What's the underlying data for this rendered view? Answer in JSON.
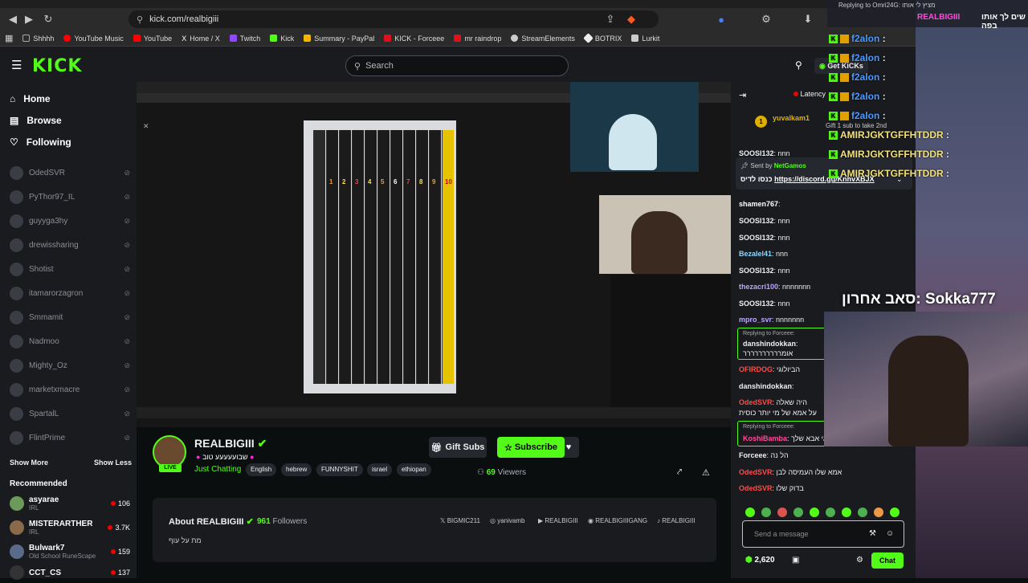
{
  "browser": {
    "url": "kick.com/realbigiii",
    "bookmarks": [
      "Shhhh",
      "YouTube Music",
      "YouTube",
      "Home / X",
      "Twitch",
      "Kick",
      "Summary - PayPal",
      "KICK - Forceee",
      "mr raindrop",
      "StreamElements",
      "BOTRIX",
      "Lurkit"
    ]
  },
  "nav": {
    "logo": "KICK",
    "search_placeholder": "Search",
    "home": "Home",
    "browse": "Browse",
    "following": "Following",
    "get_kicks": "Get KiCKs"
  },
  "following_list": [
    "OdedSVR",
    "PyThor97_IL",
    "guyyga3hy",
    "drewissharing",
    "Shotist",
    "itamarorzagron",
    "Smmamit",
    "Nadmoo",
    "Mighty_Oz",
    "marketxmacre",
    "SpartalL",
    "FlintPrime"
  ],
  "show_more": "Show More",
  "show_less": "Show Less",
  "recommended_title": "Recommended",
  "recommended": [
    {
      "name": "asyarae",
      "cat": "IRL",
      "viewers": "106"
    },
    {
      "name": "MISTERARTHER",
      "cat": "IRL",
      "viewers": "3.7K"
    },
    {
      "name": "Bulwark7",
      "cat": "Old School RuneScape",
      "viewers": "159"
    },
    {
      "name": "CCT_CS",
      "cat": "",
      "viewers": "137"
    }
  ],
  "channel": {
    "name": "REALBIGIII",
    "live": "LIVE",
    "title": "שבועעעעע טוב",
    "category": "Just Chatting",
    "tags": [
      "English",
      "hebrew",
      "FUNNYSHIT",
      "israel",
      "ethiopan"
    ],
    "gift_subs": "Gift Subs",
    "subscribe": "Subscribe",
    "viewers_count": "69",
    "viewers_label": "Viewers"
  },
  "about": {
    "title": "About REALBIGIII",
    "followers_count": "961",
    "followers_label": "Followers",
    "bio": "מת על עוף",
    "socials": [
      "BIGMIC211",
      "yanivamb",
      "REALBIGIII",
      "REALBIGIIIGANG",
      "REALBIGIII"
    ]
  },
  "video": {
    "book_numbers": [
      "1",
      "2",
      "3",
      "4",
      "5",
      "6",
      "7",
      "8",
      "9",
      "10"
    ]
  },
  "chat": {
    "latency": "Latency",
    "pinned_user": "yuvalkam1",
    "pinned_text": "Gift 1 sub to take 2nd",
    "sent_by_label": "Sent by",
    "sent_by_user": "NetGamos",
    "pinned_link": "https://discord.gg/KnhvXBJX",
    "pinned_link_prefix": "כנסו לדיס",
    "messages": [
      {
        "user": "SOOSI132",
        "text": "nnn",
        "color": "#ffffff"
      },
      {
        "user": "shamen767",
        "text": "",
        "color": "#ffffff"
      },
      {
        "user": "SOOSI132",
        "text": "nnn",
        "color": "#ffffff"
      },
      {
        "user": "SOOSI132",
        "text": "nnn",
        "color": "#ffffff"
      },
      {
        "user": "Bezalel41",
        "text": "nnn",
        "color": "#8fd8ff"
      },
      {
        "user": "SOOSI132",
        "text": "nnn",
        "color": "#ffffff"
      },
      {
        "user": "thezacri100",
        "text": "nnnnnnn",
        "color": "#bda6ff"
      },
      {
        "user": "SOOSI132",
        "text": "nnn",
        "color": "#ffffff"
      },
      {
        "user": "mpro_svr",
        "text": "nnnnnnn",
        "color": "#bda6ff"
      }
    ],
    "reply1_to": "Replying to Forceee:",
    "reply1_user": "danshindokkan",
    "reply1_text": "אומרררררררררר",
    "msg2_user": "OFIRDOG",
    "msg2_text": "הבי‌ולוגי",
    "msg3_user": "danshindokkan",
    "msg4_user": "OdedSVR",
    "msg4_text": "היה שאלה",
    "msg4_line2": "על אמא של מי יותר כוסית",
    "reply2_to": "Replying to Forceee:",
    "reply2_user": "KoshiBamba",
    "reply2_text": "גי אבא שלך",
    "msg5_user": "Forceee",
    "msg5_text": "הל נה",
    "msg6_user": "OdedSVR",
    "msg6_text": "אמא שלו העמיסה לבן",
    "msg7_user": "OdedSVR",
    "msg7_text": "בדוק שלו",
    "input_placeholder": "Send a message",
    "chat_button": "Chat",
    "points": "2,620"
  },
  "overlay": {
    "replying_header": "Replying to Omri24G: מציץ לי אותו",
    "top_msg_user": "REALBIGIII",
    "top_msg_text": "שים לך אותו בפה",
    "lines": [
      {
        "user": "f2alon",
        "text": ":"
      },
      {
        "user": "f2alon",
        "text": ":"
      },
      {
        "user": "f2alon",
        "text": ":"
      },
      {
        "user": "f2alon",
        "text": ":"
      },
      {
        "user": "f2alon",
        "text": ":"
      },
      {
        "user": "AMIRJGKTGFFHTDDR",
        "text": ":"
      },
      {
        "user": "AMIRJGKTGFFHTDDR",
        "text": ":"
      },
      {
        "user": "AMIRJGKTGFFHTDDR",
        "text": ":"
      }
    ],
    "last_sub_label": "סאב אחרון: Sokka777"
  }
}
